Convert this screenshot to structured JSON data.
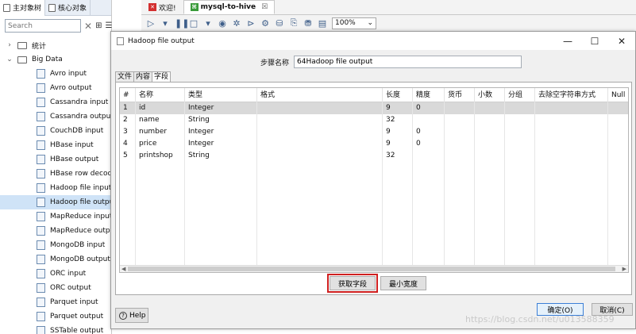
{
  "left_panel": {
    "tabs": [
      {
        "label": "主对象树",
        "active": true
      },
      {
        "label": "核心对象",
        "active": false
      }
    ],
    "search": {
      "value": "",
      "placeholder": "Search"
    },
    "tree": {
      "folders": [
        "统计",
        "Big Data"
      ],
      "items": [
        {
          "label": "Avro input",
          "icon": "avro-icon"
        },
        {
          "label": "Avro output",
          "icon": "avro-icon"
        },
        {
          "label": "Cassandra input",
          "icon": "cassandra-icon"
        },
        {
          "label": "Cassandra output",
          "icon": "cassandra-icon"
        },
        {
          "label": "CouchDB input",
          "icon": "couchdb-icon"
        },
        {
          "label": "HBase input",
          "icon": "hbase-icon"
        },
        {
          "label": "HBase output",
          "icon": "hbase-icon"
        },
        {
          "label": "HBase row decoder",
          "icon": "hbase-icon"
        },
        {
          "label": "Hadoop file input",
          "icon": "hadoop-icon"
        },
        {
          "label": "Hadoop file output",
          "icon": "hadoop-icon",
          "selected": true
        },
        {
          "label": "MapReduce input",
          "icon": "mapreduce-icon"
        },
        {
          "label": "MapReduce output",
          "icon": "mapreduce-icon"
        },
        {
          "label": "MongoDB input",
          "icon": "mongodb-icon"
        },
        {
          "label": "MongoDB output",
          "icon": "mongodb-icon"
        },
        {
          "label": "ORC input",
          "icon": "orc-icon"
        },
        {
          "label": "ORC output",
          "icon": "orc-icon"
        },
        {
          "label": "Parquet input",
          "icon": "parquet-icon"
        },
        {
          "label": "Parquet output",
          "icon": "parquet-icon"
        },
        {
          "label": "SSTable output",
          "icon": "sstable-icon"
        }
      ]
    }
  },
  "editor": {
    "tabs": [
      {
        "label": "欢迎!",
        "active": false
      },
      {
        "label": "mysql-to-hive",
        "active": true,
        "close": "☒"
      }
    ],
    "zoom": "100%"
  },
  "dialog": {
    "title": "Hadoop file output",
    "step_name_label": "步骤名称",
    "step_name_value": "64Hadoop file output",
    "tabs": [
      "文件",
      "内容",
      "字段"
    ],
    "active_tab": "字段",
    "table": {
      "headers": [
        "#",
        "名称",
        "类型",
        "格式",
        "长度",
        "精度",
        "货币",
        "小数",
        "分组",
        "去除空字符串方式",
        "Null"
      ],
      "rows": [
        [
          "1",
          "id",
          "Integer",
          "",
          "9",
          "0",
          "",
          "",
          "",
          "",
          ""
        ],
        [
          "2",
          "name",
          "String",
          "",
          "32",
          "",
          "",
          "",
          "",
          "",
          ""
        ],
        [
          "3",
          "number",
          "Integer",
          "",
          "9",
          "0",
          "",
          "",
          "",
          "",
          ""
        ],
        [
          "4",
          "price",
          "Integer",
          "",
          "9",
          "0",
          "",
          "",
          "",
          "",
          ""
        ],
        [
          "5",
          "printshop",
          "String",
          "",
          "32",
          "",
          "",
          "",
          "",
          "",
          ""
        ]
      ],
      "selected_row": 0
    },
    "buttons": {
      "get_fields": "获取字段",
      "min_width": "最小宽度",
      "help": "Help",
      "ok": "确定(O)",
      "cancel": "取消(C)"
    }
  },
  "watermark": "https://blog.csdn.net/u013588359"
}
